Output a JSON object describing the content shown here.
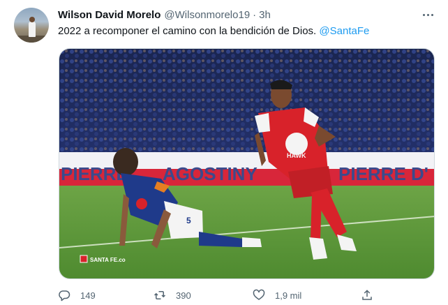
{
  "tweet": {
    "author_name": "Wilson David Morelo",
    "handle": "@Wilsonmorelo19",
    "separator": "·",
    "time": "3h",
    "text": "2022 a recomponer el camino con la bendición de Dios.",
    "mention": "@SantaFe",
    "more_icon": "more-horizontal-icon"
  },
  "media": {
    "banner_texts": [
      "PIERRE",
      "AGOSTINY",
      "PIERRE D'"
    ],
    "shirt_brand": "HAWK",
    "shirt_number": "5",
    "watermark": "SANTA FE.co",
    "colors": {
      "santa_fe_red": "#d8222a",
      "millonarios_blue": "#1f3a8a",
      "pitch_green": "#5f9a3a"
    }
  },
  "actions": {
    "reply_count": "149",
    "retweet_count": "390",
    "like_count": "1,9 mil",
    "icons": [
      "reply-icon",
      "retweet-icon",
      "like-icon",
      "share-icon"
    ]
  }
}
